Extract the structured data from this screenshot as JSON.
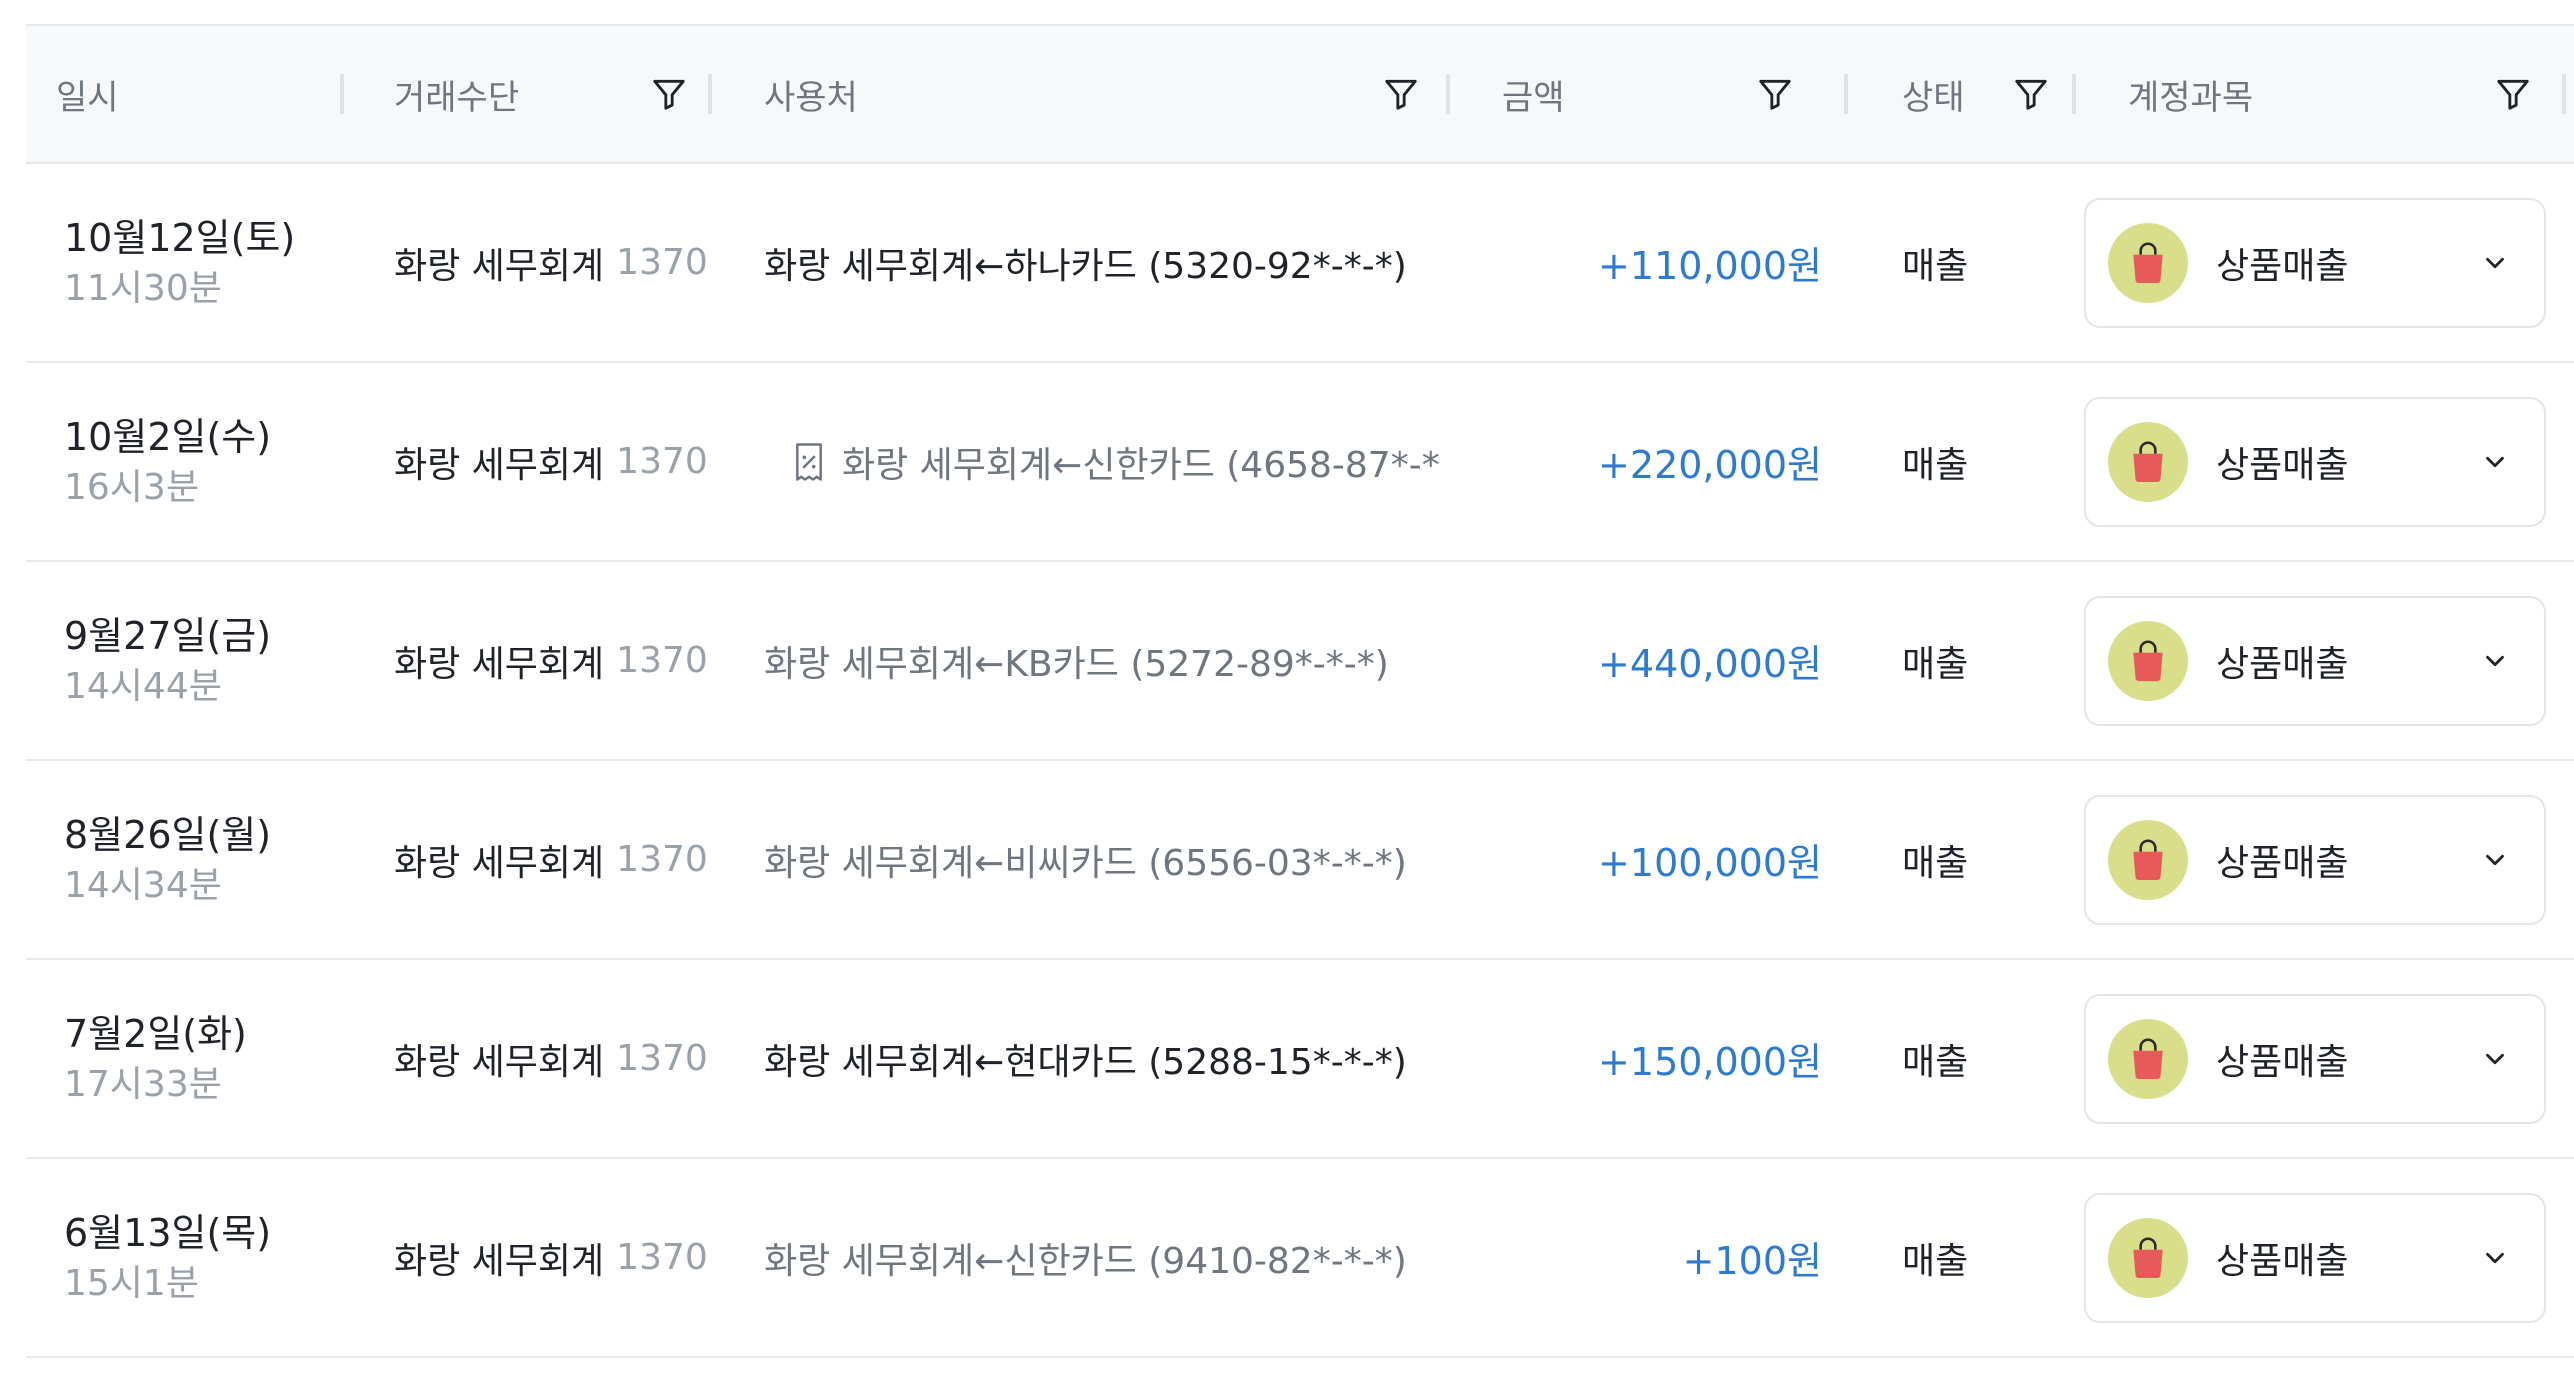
{
  "header": {
    "date": "일시",
    "method": "거래수단",
    "merchant": "사용처",
    "amount": "금액",
    "status": "상태",
    "account": "계정과목"
  },
  "icons": {
    "filter": "filter-icon",
    "receipt": "receipt-icon",
    "bag": "shopping-bag-icon",
    "chevron": "chevron-down-icon"
  },
  "colors": {
    "amount_positive": "#2d7bd1",
    "badge_bg": "#d9de8a",
    "bag": "#e85a5a"
  },
  "rows": [
    {
      "date": "10월12일(토)",
      "time": "11시30분",
      "method": "화랑 세무회계",
      "method_num": "1370",
      "merchant": "화랑 세무회계←하나카드 (5320-92*-*-*)",
      "has_receipt": false,
      "amount": "+110,000원",
      "status": "매출",
      "account": "상품매출"
    },
    {
      "date": "10월2일(수)",
      "time": "16시3분",
      "method": "화랑 세무회계",
      "method_num": "1370",
      "merchant": "화랑 세무회계←신한카드 (4658-87*-*",
      "has_receipt": true,
      "amount": "+220,000원",
      "status": "매출",
      "account": "상품매출"
    },
    {
      "date": "9월27일(금)",
      "time": "14시44분",
      "method": "화랑 세무회계",
      "method_num": "1370",
      "merchant": "화랑 세무회계←KB카드 (5272-89*-*-*)",
      "has_receipt": false,
      "amount": "+440,000원",
      "status": "매출",
      "account": "상품매출"
    },
    {
      "date": "8월26일(월)",
      "time": "14시34분",
      "method": "화랑 세무회계",
      "method_num": "1370",
      "merchant": "화랑 세무회계←비씨카드 (6556-03*-*-*)",
      "has_receipt": false,
      "amount": "+100,000원",
      "status": "매출",
      "account": "상품매출"
    },
    {
      "date": "7월2일(화)",
      "time": "17시33분",
      "method": "화랑 세무회계",
      "method_num": "1370",
      "merchant": "화랑 세무회계←현대카드 (5288-15*-*-*)",
      "has_receipt": false,
      "amount": "+150,000원",
      "status": "매출",
      "account": "상품매출"
    },
    {
      "date": "6월13일(목)",
      "time": "15시1분",
      "method": "화랑 세무회계",
      "method_num": "1370",
      "merchant": "화랑 세무회계←신한카드 (9410-82*-*-*)",
      "has_receipt": false,
      "amount": "+100원",
      "status": "매출",
      "account": "상품매출"
    }
  ]
}
